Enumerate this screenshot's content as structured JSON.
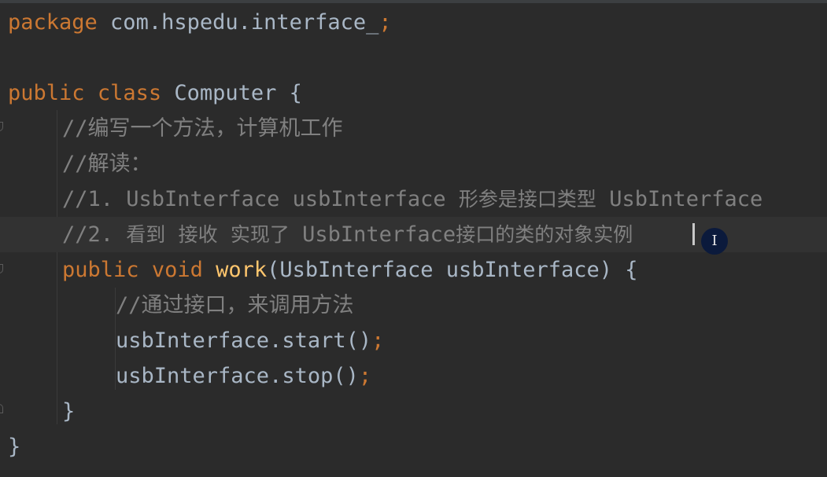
{
  "editor": {
    "theme": {
      "background": "#2b2b2b",
      "current_line": "#323232",
      "keyword": "#cc7832",
      "function": "#ffc66d",
      "comment": "#808080",
      "text": "#a9b7c6"
    },
    "lines": {
      "l1": {
        "kw": "package",
        "text": " com.hspedu.interface_",
        "semi": ";"
      },
      "l3": {
        "kw1": "public",
        "kw2": "class",
        "name": " Computer ",
        "brace": "{"
      },
      "l4": {
        "text": "//编写一个方法，计算机工作"
      },
      "l5": {
        "text": "//解读："
      },
      "l6": {
        "prefix": "//1. UsbInterface usbInterface ",
        "cjk": "形参是接口类型",
        "suffix": " UsbInterface"
      },
      "l7": {
        "p1": "//2. ",
        "c1": "看到",
        "p2": " ",
        "c2": "接收",
        "p3": " ",
        "c3": "实现了",
        "p4": " UsbInterface",
        "c4": "接口的类的对象实例"
      },
      "l8": {
        "kw1": "public",
        "kw2": "void",
        "fn": "work",
        "params": "(UsbInterface usbInterface) {"
      },
      "l9": {
        "text": "//通过接口，来调用方法"
      },
      "l10": {
        "call": "usbInterface.start()",
        "semi": ";"
      },
      "l11": {
        "call": "usbInterface.stop()",
        "semi": ";"
      },
      "l12": {
        "brace": "}"
      },
      "l13": {
        "brace": "}"
      }
    },
    "cursor_icon": "text-cursor-icon",
    "cursor_glyph": "I"
  }
}
